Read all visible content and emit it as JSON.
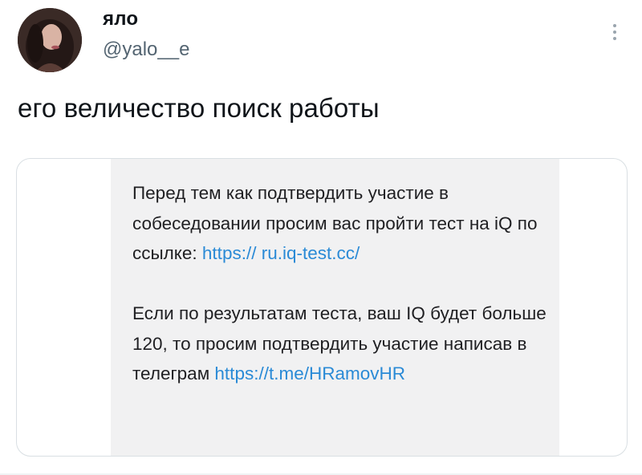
{
  "tweet": {
    "display_name": "яло",
    "handle": "@yalo__e",
    "text": "его величество поиск работы",
    "more_icon": "more-vertical-icon"
  },
  "message": {
    "p1_text": "Перед тем как подтвердить участие в собеседовании просим вас пройти тест на iQ по ссылке: ",
    "p1_link": "https:// ru.iq-test.cc/",
    "p2_text": "Если по результатам теста, ваш IQ будет больше 120, то просим подтвердить участие написав в телеграм ",
    "p2_link": "https://t.me/HRamovHR"
  },
  "colors": {
    "text": "#0f1419",
    "secondary": "#536471",
    "link": "#2a8ad6",
    "message_bg": "#f1f1f2",
    "border": "#d9dfe3"
  }
}
